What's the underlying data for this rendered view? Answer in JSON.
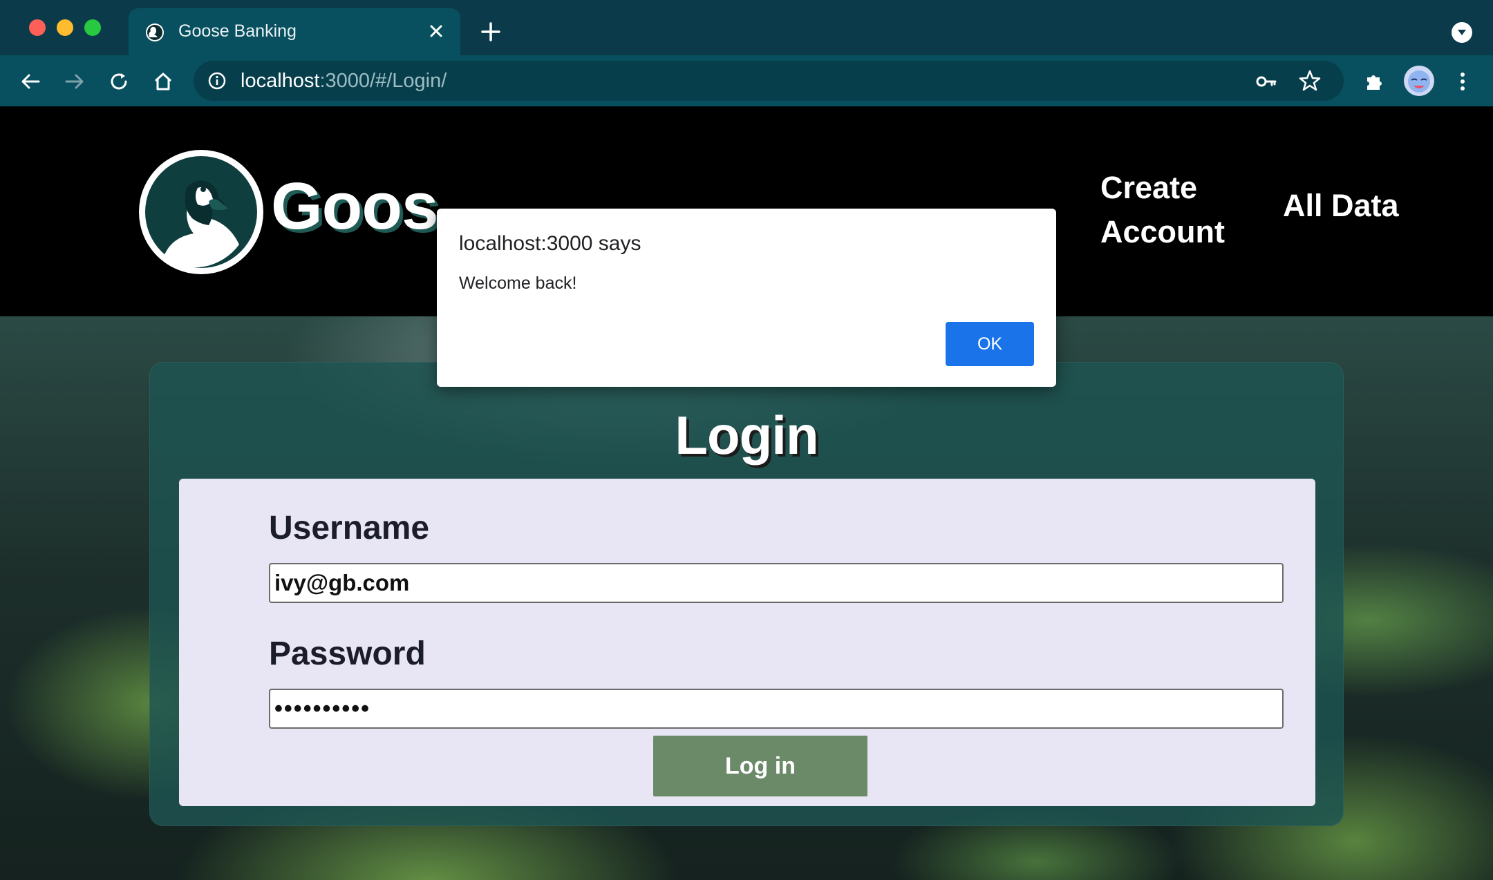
{
  "browser": {
    "tab_title": "Goose Banking",
    "url_host": "localhost",
    "url_path": ":3000/#/Login/"
  },
  "navbar": {
    "brand": "Goos",
    "create_account": "Create Account",
    "all_data": "All Data"
  },
  "login": {
    "title": "Login",
    "username_label": "Username",
    "username_value": "ivy@gb.com",
    "password_label": "Password",
    "password_value": "••••••••••",
    "submit_label": "Log in"
  },
  "alert": {
    "title": "localhost:3000 says",
    "message": "Welcome back!",
    "ok_label": "OK"
  },
  "colors": {
    "chrome_dark": "#0b3b4b",
    "chrome_toolbar": "#08505f",
    "button_green": "#6b8a68",
    "alert_blue": "#1a73e8"
  }
}
